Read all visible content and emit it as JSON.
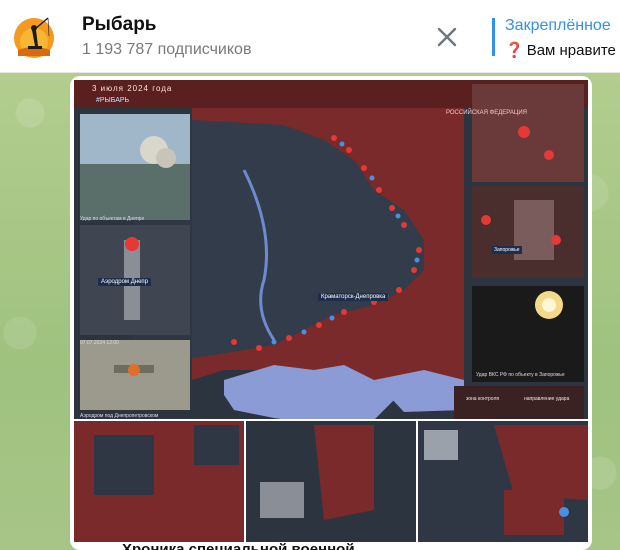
{
  "channel": {
    "name": "Рыбарь",
    "subscribers": "1 193 787 подписчиков"
  },
  "pinned": {
    "label": "Закреплённое",
    "text": "Вам нравите"
  },
  "post": {
    "map_date": "3 июля 2024 года",
    "map_tag": "#РЫБАРЬ",
    "region_label": "РОССИЙСКАЯ ФЕДЕРАЦИЯ",
    "inset_city_1": "Аэродром Днепр",
    "inset_city_2": "Краматорск-Днепровка",
    "inset_city_3": "Запорожье",
    "caption_1": "Удар по объектам в Днепре",
    "caption_2": "07.07.2024 12:00",
    "caption_3": "Аэродром под Днепропетровском",
    "caption_4": "Удар ВКС РФ по объекту в Запорожье",
    "legend_1": "зона контроля",
    "legend_2": "направление удара",
    "text_line": "Хроника специальной военной"
  },
  "icons": {
    "close": "close-icon",
    "pin_question": "question-icon",
    "avatar": "fisherman-logo-icon"
  },
  "colors": {
    "accent": "#3390ec",
    "map_red": "#7a2a2a",
    "map_dark": "#2c3440",
    "sea": "#8a9bd6",
    "chat_green": "#a8c58a"
  }
}
